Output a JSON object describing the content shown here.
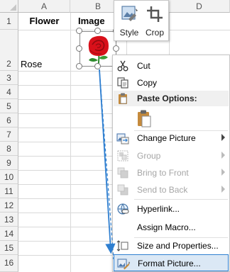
{
  "sheet": {
    "columns": [
      "A",
      "B",
      "D"
    ],
    "rows": [
      "1",
      "2",
      "3",
      "4",
      "5",
      "6",
      "7",
      "8",
      "9",
      "10",
      "11",
      "12",
      "13",
      "14",
      "15",
      "16"
    ],
    "header_flower": "Flower",
    "header_image": "Image",
    "cell_rose": "Rose"
  },
  "mini_toolbar": {
    "style_label": "Style",
    "crop_label": "Crop"
  },
  "menu": {
    "cut": "Cut",
    "copy": "Copy",
    "paste_options": "Paste Options:",
    "change_picture": "Change Picture",
    "group": "Group",
    "bring_to_front": "Bring to Front",
    "send_to_back": "Send to Back",
    "hyperlink": "Hyperlink...",
    "assign_macro": "Assign Macro...",
    "size_and_properties": "Size and Properties...",
    "format_picture": "Format Picture..."
  },
  "colors": {
    "highlight_bg": "#dbe8f5",
    "highlight_border": "#2f7fd0",
    "arrow": "#2f7fd0",
    "rose_red": "#d8101a",
    "leaf_green": "#2e8b2e"
  }
}
